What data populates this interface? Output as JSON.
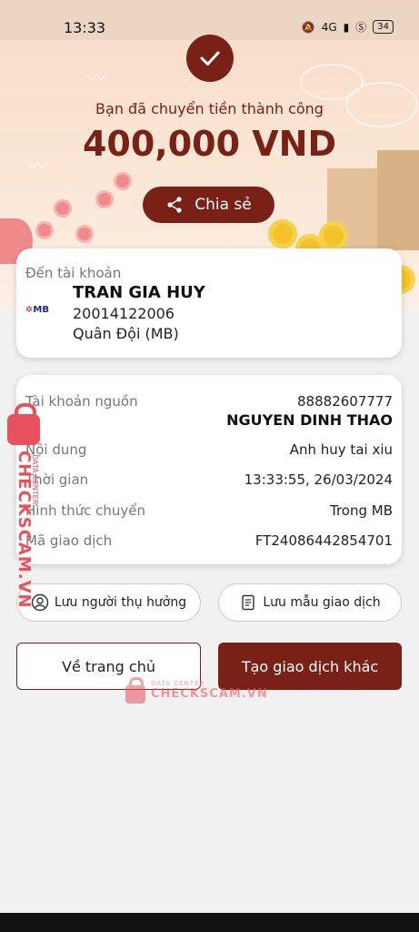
{
  "status_bar": {
    "time": "13:33",
    "network": "4G",
    "battery": "34"
  },
  "hero": {
    "success_message": "Bạn đã chuyển tiền thành công",
    "amount": "400,000 VND",
    "share_label": "Chia sẻ"
  },
  "recipient": {
    "label": "Đến tài khoản",
    "name": "TRAN GIA HUY",
    "account_number": "20014122006",
    "bank": "Quân Đội (MB)",
    "bank_logo_text": "MB"
  },
  "details": {
    "source_label": "Tài khoản nguồn",
    "source_account": "88882607777",
    "source_name": "NGUYEN DINH THAO",
    "content_label": "Nội dung",
    "content_value": "Anh huy tai xiu",
    "time_label": "Thời gian",
    "time_value": "13:33:55, 26/03/2024",
    "method_label": "Hình thức chuyển",
    "method_value": "Trong MB",
    "txid_label": "Mã giao dịch",
    "txid_value": "FT24086442854701"
  },
  "actions": {
    "save_recipient": "Lưu người thụ hưởng",
    "save_template": "Lưu mẫu giao dịch",
    "home": "Về trang chủ",
    "new_transaction": "Tạo giao dịch khác"
  },
  "watermark": {
    "brand": "CHECKSCAM.VN",
    "tagline": "DATA CENTER"
  },
  "colors": {
    "brand": "#7a2117",
    "watermark": "#e8515e"
  }
}
